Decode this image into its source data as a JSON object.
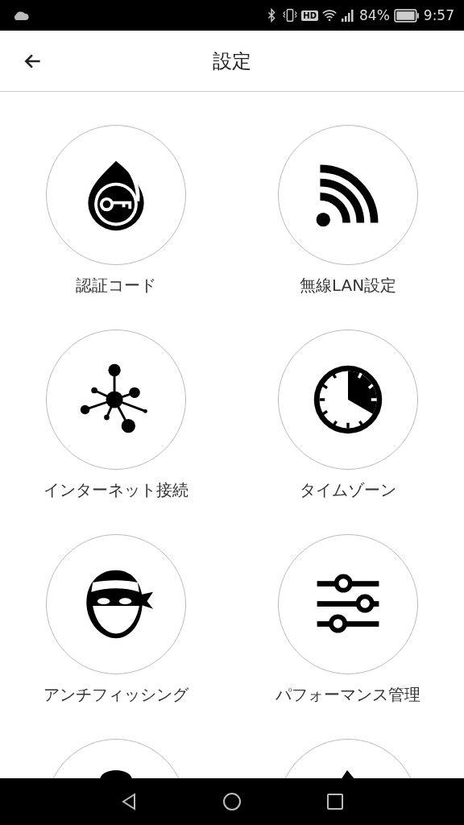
{
  "status_bar": {
    "hd_badge": "HD",
    "battery_percent": "84%",
    "time": "9:57"
  },
  "header": {
    "title": "設定"
  },
  "items": [
    {
      "kind": "key-drop",
      "label": "認証コード"
    },
    {
      "kind": "wireless",
      "label": "無線LAN設定"
    },
    {
      "kind": "network",
      "label": "インターネット接続"
    },
    {
      "kind": "clock",
      "label": "タイムゾーン"
    },
    {
      "kind": "mask",
      "label": "アンチフィッシング"
    },
    {
      "kind": "sliders",
      "label": "パフォーマンス管理"
    },
    {
      "kind": "partial-round"
    },
    {
      "kind": "partial-peak"
    }
  ]
}
